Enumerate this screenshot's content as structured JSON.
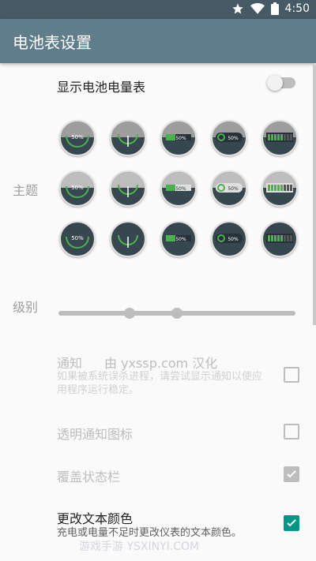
{
  "status_bar": {
    "time": "4:50",
    "icons": [
      "star-icon",
      "wifi-icon",
      "battery-icon"
    ]
  },
  "app_bar": {
    "title": "电池表设置"
  },
  "show_meter": {
    "label": "显示电池电量表",
    "enabled": false
  },
  "theme": {
    "label": "主题",
    "badge_text": "50%"
  },
  "level": {
    "label": "级别",
    "low_value": 0.3,
    "high_value": 0.5
  },
  "notification": {
    "label": "通知",
    "credit": "由 yxssp.com 汉化",
    "summary": "如果被系统误杀进程，请尝试显示通知以使应用程序运行稳定。",
    "checked": false
  },
  "transparent_icon": {
    "label": "透明通知图标",
    "checked": false
  },
  "overlay_statusbar": {
    "label": "覆盖状态栏",
    "checked": true
  },
  "change_text_color": {
    "label": "更改文本颜色",
    "summary": "充电或电量不足时更改仪表的文本颜色。",
    "checked": true
  },
  "watermark": "游戏手游 YSXINYI.COM",
  "colors": {
    "app_bar": "#607d8b",
    "status_bar": "#455a64",
    "accent": "#009688",
    "meter_bg": "#37474f",
    "meter_green": "#4caf50"
  }
}
